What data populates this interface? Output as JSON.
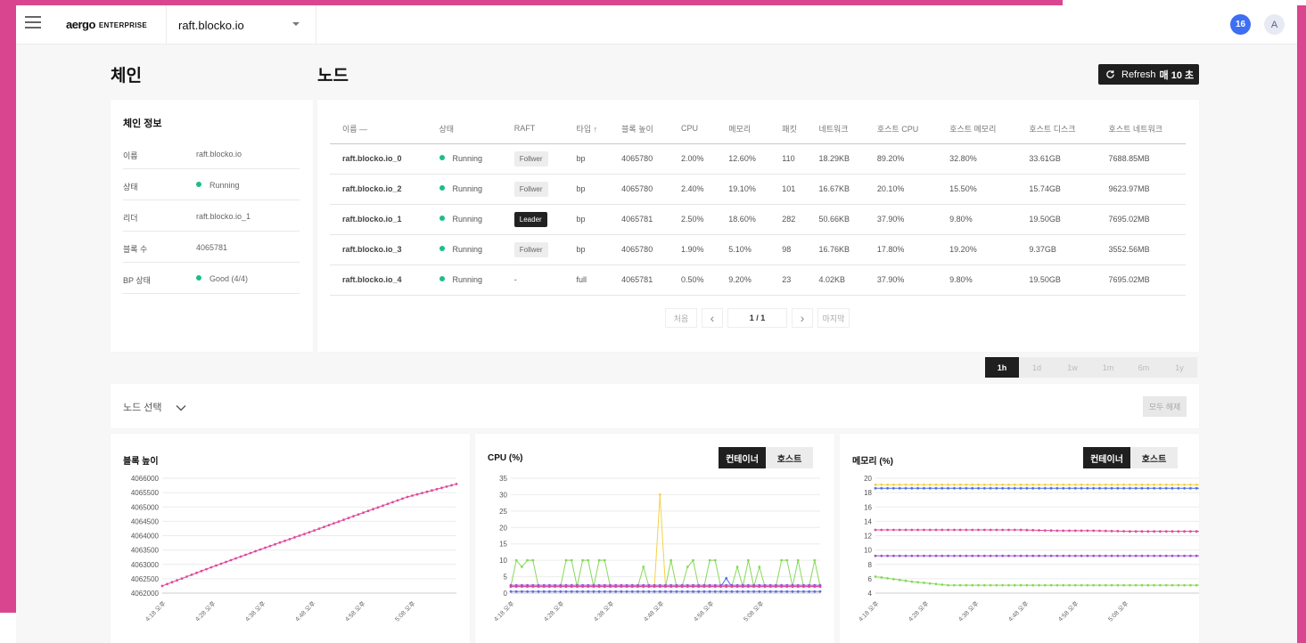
{
  "topbar": {
    "logo": "aergo",
    "logo_sub": "ENTERPRISE",
    "chain": "raft.blocko.io",
    "notifications": "16",
    "avatar": "A"
  },
  "sections": {
    "chain": "체인",
    "node": "노드"
  },
  "refresh": {
    "label": "Refresh",
    "interval": "매 10 초"
  },
  "chain_info": {
    "title": "체인 정보",
    "rows": [
      {
        "key": "이름",
        "value": "raft.blocko.io"
      },
      {
        "key": "상태",
        "value": "Running"
      },
      {
        "key": "리더",
        "value": "raft.blocko.io_1"
      },
      {
        "key": "블록 수",
        "value": "4065781"
      },
      {
        "key": "BP 상태",
        "value": "Good (4/4)"
      }
    ]
  },
  "table": {
    "headers": [
      "이름 —",
      "상태",
      "RAFT",
      "타입 ↑",
      "블록 높이",
      "CPU",
      "메모리",
      "패킷",
      "네트워크",
      "호스트 CPU",
      "호스트 메모리",
      "호스트 디스크",
      "호스트 네트워크"
    ],
    "rows": [
      [
        "raft.blocko.io_0",
        "Running",
        "Follwer",
        "bp",
        "4065780",
        "2.00%",
        "12.60%",
        "110",
        "18.29KB",
        "89.20%",
        "32.80%",
        "33.61GB",
        "7688.85MB"
      ],
      [
        "raft.blocko.io_2",
        "Running",
        "Follwer",
        "bp",
        "4065780",
        "2.40%",
        "19.10%",
        "101",
        "16.67KB",
        "20.10%",
        "15.50%",
        "15.74GB",
        "9623.97MB"
      ],
      [
        "raft.blocko.io_1",
        "Running",
        "Leader",
        "bp",
        "4065781",
        "2.50%",
        "18.60%",
        "282",
        "50.66KB",
        "37.90%",
        "9.80%",
        "19.50GB",
        "7695.02MB"
      ],
      [
        "raft.blocko.io_3",
        "Running",
        "Follwer",
        "bp",
        "4065780",
        "1.90%",
        "5.10%",
        "98",
        "16.76KB",
        "17.80%",
        "19.20%",
        "9.37GB",
        "3552.56MB"
      ],
      [
        "raft.blocko.io_4",
        "Running",
        "-",
        "full",
        "4065781",
        "0.50%",
        "9.20%",
        "23",
        "4.02KB",
        "37.90%",
        "9.80%",
        "19.50GB",
        "7695.02MB"
      ]
    ]
  },
  "pager": {
    "first": "처음",
    "prev": "‹",
    "page": "1 / 1",
    "next": "›",
    "last": "마지막"
  },
  "ranges": [
    "1h",
    "1d",
    "1w",
    "1m",
    "6m",
    "1y"
  ],
  "node_select": {
    "label": "노드 선택",
    "clear": "모두 해제"
  },
  "toggle": {
    "container": "컨테이너",
    "host": "호스트"
  },
  "colors": {
    "running": "#1cbf82",
    "pink": "#e0499b",
    "yellow": "#f5d246",
    "green": "#86d95a",
    "blue": "#4a6df0",
    "purple": "#9a4fd6"
  },
  "chart_data": [
    {
      "type": "line",
      "title": "블록 높이",
      "x": [
        "4:18 오후",
        "4:28 오후",
        "4:38 오후",
        "4:48 오후",
        "4:58 오후",
        "5:08 오후"
      ],
      "y_ticks": [
        4062000,
        4062500,
        4063000,
        4063500,
        4064000,
        4064500,
        4065000,
        4065500,
        4066000
      ],
      "ylim": [
        4062000,
        4066000
      ],
      "series": [
        {
          "color": "#e0499b",
          "values": [
            4062250,
            4062900,
            4063520,
            4064120,
            4064740,
            4065350,
            4065800
          ]
        }
      ]
    },
    {
      "type": "line",
      "title": "CPU (%)",
      "x": [
        "4:18 오후",
        "4:28 오후",
        "4:38 오후",
        "4:48 오후",
        "4:58 오후",
        "5:08 오후"
      ],
      "y_ticks": [
        0,
        5,
        10,
        15,
        20,
        25,
        30,
        35
      ],
      "ylim": [
        0,
        35
      ],
      "series": [
        {
          "color": "#86d95a",
          "values": [
            2,
            10,
            8,
            10,
            10,
            2,
            2,
            2,
            2,
            2,
            10,
            10,
            2,
            10,
            10,
            2,
            10,
            10,
            2,
            2,
            2,
            2,
            2,
            2,
            8,
            2,
            2,
            2,
            2,
            10,
            2,
            2,
            8,
            10,
            2,
            2,
            10,
            10,
            2,
            2,
            2,
            8,
            2,
            10,
            2,
            8,
            2,
            2,
            2,
            10,
            10,
            2,
            10,
            2,
            2,
            10,
            2
          ]
        },
        {
          "color": "#f5d246",
          "values": [
            2,
            2,
            2,
            2,
            2,
            2,
            2,
            2,
            2,
            2,
            2,
            2,
            2,
            2,
            2,
            2,
            2,
            2,
            2,
            2,
            2,
            2,
            2,
            2,
            2,
            2,
            2,
            30,
            2,
            2,
            2,
            2,
            2,
            2,
            2,
            2,
            2,
            2,
            2,
            2,
            2,
            2,
            2,
            2,
            2,
            2,
            2,
            2,
            2,
            2,
            2,
            2,
            2,
            2,
            2,
            2,
            2
          ]
        },
        {
          "color": "#4a6df0",
          "values": [
            2,
            2,
            2,
            2,
            2,
            2,
            2,
            2,
            2,
            2,
            2,
            2,
            2,
            2,
            2,
            2,
            2,
            2,
            2,
            2,
            2,
            2,
            2,
            2,
            2,
            2,
            2,
            2,
            2,
            2,
            2,
            2,
            2,
            2,
            2,
            2,
            2,
            2,
            2,
            4.5,
            2,
            2,
            2,
            2,
            2,
            2,
            2,
            2,
            2,
            2,
            2,
            2,
            2,
            2,
            2,
            2,
            2
          ]
        },
        {
          "color": "#9a4fd6",
          "values": [
            2.4,
            2.4,
            2.4,
            2.4,
            2.4,
            2.4,
            2.4,
            2.4,
            2.4,
            2.4,
            2.4,
            2.4,
            2.4,
            2.4,
            2.4,
            2.4,
            2.4,
            2.4,
            2.4,
            2.4,
            2.4,
            2.4,
            2.4,
            2.4,
            2.4,
            2.4,
            2.4,
            2.4,
            2.4,
            2.4,
            2.4,
            2.4,
            2.4,
            2.4,
            2.4,
            2.4,
            2.4,
            2.4,
            2.4,
            2.4,
            2.4,
            2.4,
            2.4,
            2.4,
            2.4,
            2.4,
            2.4,
            2.4,
            2.4,
            2.4,
            2.4,
            2.4,
            2.4,
            2.4,
            2.4,
            2.4,
            2.4
          ]
        },
        {
          "color": "#e0499b",
          "values": [
            2.0,
            2.0,
            2.0,
            2.0,
            2.0,
            2.0,
            2.0,
            2.0,
            2.0,
            2.0,
            2.0,
            2.0,
            2.0,
            2.0,
            2.0,
            2.0,
            2.0,
            2.0,
            2.0,
            2.0,
            2.0,
            2.0,
            2.0,
            2.0,
            2.0,
            2.0,
            2.0,
            2.0,
            2.0,
            2.0,
            2.0,
            2.0,
            2.0,
            2.0,
            2.0,
            2.0,
            2.0,
            2.0,
            2.0,
            2.0,
            2.0,
            2.0,
            2.0,
            2.0,
            2.0,
            2.0,
            2.0,
            2.0,
            2.0,
            2.0,
            2.0,
            2.0,
            2.0,
            2.0,
            2.0,
            2.0,
            2.0
          ]
        },
        {
          "color": "#5f6fd8",
          "values": [
            0.5,
            0.5,
            0.5,
            0.5,
            0.5,
            0.5,
            0.5,
            0.5,
            0.5,
            0.5,
            0.5,
            0.5,
            0.5,
            0.5,
            0.5,
            0.5,
            0.5,
            0.5,
            0.5,
            0.5,
            0.5,
            0.5,
            0.5,
            0.5,
            0.5,
            0.5,
            0.5,
            0.5,
            0.5,
            0.5,
            0.5,
            0.5,
            0.5,
            0.5,
            0.5,
            0.5,
            0.5,
            0.5,
            0.5,
            0.5,
            0.5,
            0.5,
            0.5,
            0.5,
            0.5,
            0.5,
            0.5,
            0.5,
            0.5,
            0.5,
            0.5,
            0.5,
            0.5,
            0.5,
            0.5,
            0.5,
            0.5
          ]
        }
      ]
    },
    {
      "type": "line",
      "title": "메모리 (%)",
      "x": [
        "4:18 오후",
        "4:28 오후",
        "4:38 오후",
        "4:48 오후",
        "4:58 오후",
        "5:08 오후"
      ],
      "y_ticks": [
        4,
        6,
        8,
        10,
        12,
        14,
        16,
        18,
        20
      ],
      "ylim": [
        4,
        20
      ],
      "series": [
        {
          "color": "#f5d246",
          "values": [
            19.1,
            19.1,
            19.1,
            19.1,
            19.1,
            19.1,
            19.1,
            19.1,
            19.1,
            19.1
          ]
        },
        {
          "color": "#4a6df0",
          "values": [
            18.6,
            18.6,
            18.6,
            18.6,
            18.6,
            18.6,
            18.6,
            18.6,
            18.6,
            18.6
          ]
        },
        {
          "color": "#e0499b",
          "values": [
            12.8,
            12.8,
            12.8,
            12.8,
            12.8,
            12.7,
            12.7,
            12.6,
            12.6,
            12.6
          ]
        },
        {
          "color": "#9a4fd6",
          "values": [
            9.2,
            9.2,
            9.2,
            9.2,
            9.2,
            9.2,
            9.2,
            9.2,
            9.2,
            9.2
          ]
        },
        {
          "color": "#86d95a",
          "values": [
            6.3,
            5.6,
            5.1,
            5.1,
            5.1,
            5.1,
            5.1,
            5.1,
            5.1,
            5.1
          ]
        }
      ]
    }
  ]
}
